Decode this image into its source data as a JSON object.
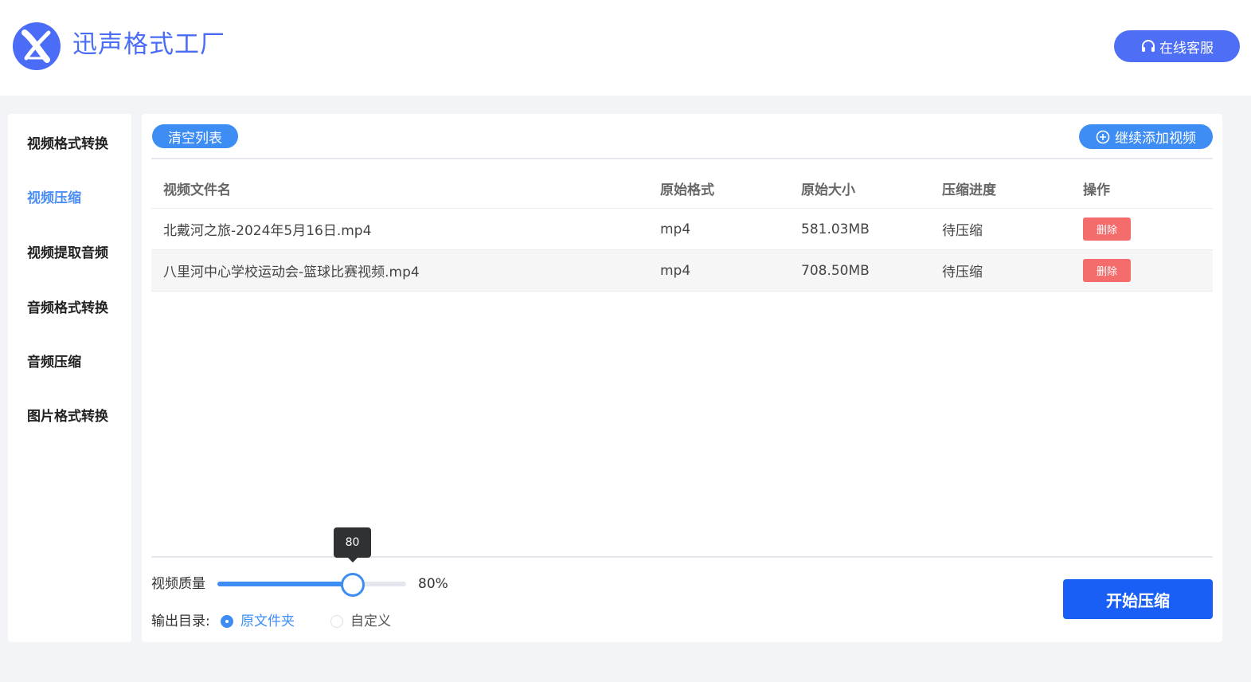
{
  "header": {
    "app_title": "迅声格式工厂",
    "support_label": "在线客服"
  },
  "sidebar": {
    "items": [
      {
        "label": "视频格式转换",
        "active": false
      },
      {
        "label": "视频压缩",
        "active": true
      },
      {
        "label": "视频提取音频",
        "active": false
      },
      {
        "label": "音频格式转换",
        "active": false
      },
      {
        "label": "音频压缩",
        "active": false
      },
      {
        "label": "图片格式转换",
        "active": false
      }
    ]
  },
  "main": {
    "clear_label": "清空列表",
    "add_label": "继续添加视频",
    "table": {
      "headers": [
        "视频文件名",
        "原始格式",
        "原始大小",
        "压缩进度",
        "操作"
      ],
      "rows": [
        {
          "name": "北戴河之旅-2024年5月16日.mp4",
          "format": "mp4",
          "size": "581.03MB",
          "progress": "待压缩",
          "action": "删除"
        },
        {
          "name": "八里河中心学校运动会-篮球比赛视频.mp4",
          "format": "mp4",
          "size": "708.50MB",
          "progress": "待压缩",
          "action": "删除"
        }
      ]
    },
    "quality": {
      "label": "视频质量",
      "value": 80,
      "tooltip": "80",
      "value_text": "80%"
    },
    "output": {
      "label": "输出目录:",
      "options": [
        {
          "label": "原文件夹",
          "checked": true
        },
        {
          "label": "自定义",
          "checked": false
        }
      ]
    },
    "start_label": "开始压缩"
  },
  "colors": {
    "accent": "#3d8df5",
    "brand": "#4d6ef5",
    "danger": "#f56c6c",
    "start": "#1a5ff5"
  },
  "icons": {
    "logo": "x-logo-icon",
    "support": "headset-icon",
    "add": "plus-circle-icon"
  }
}
